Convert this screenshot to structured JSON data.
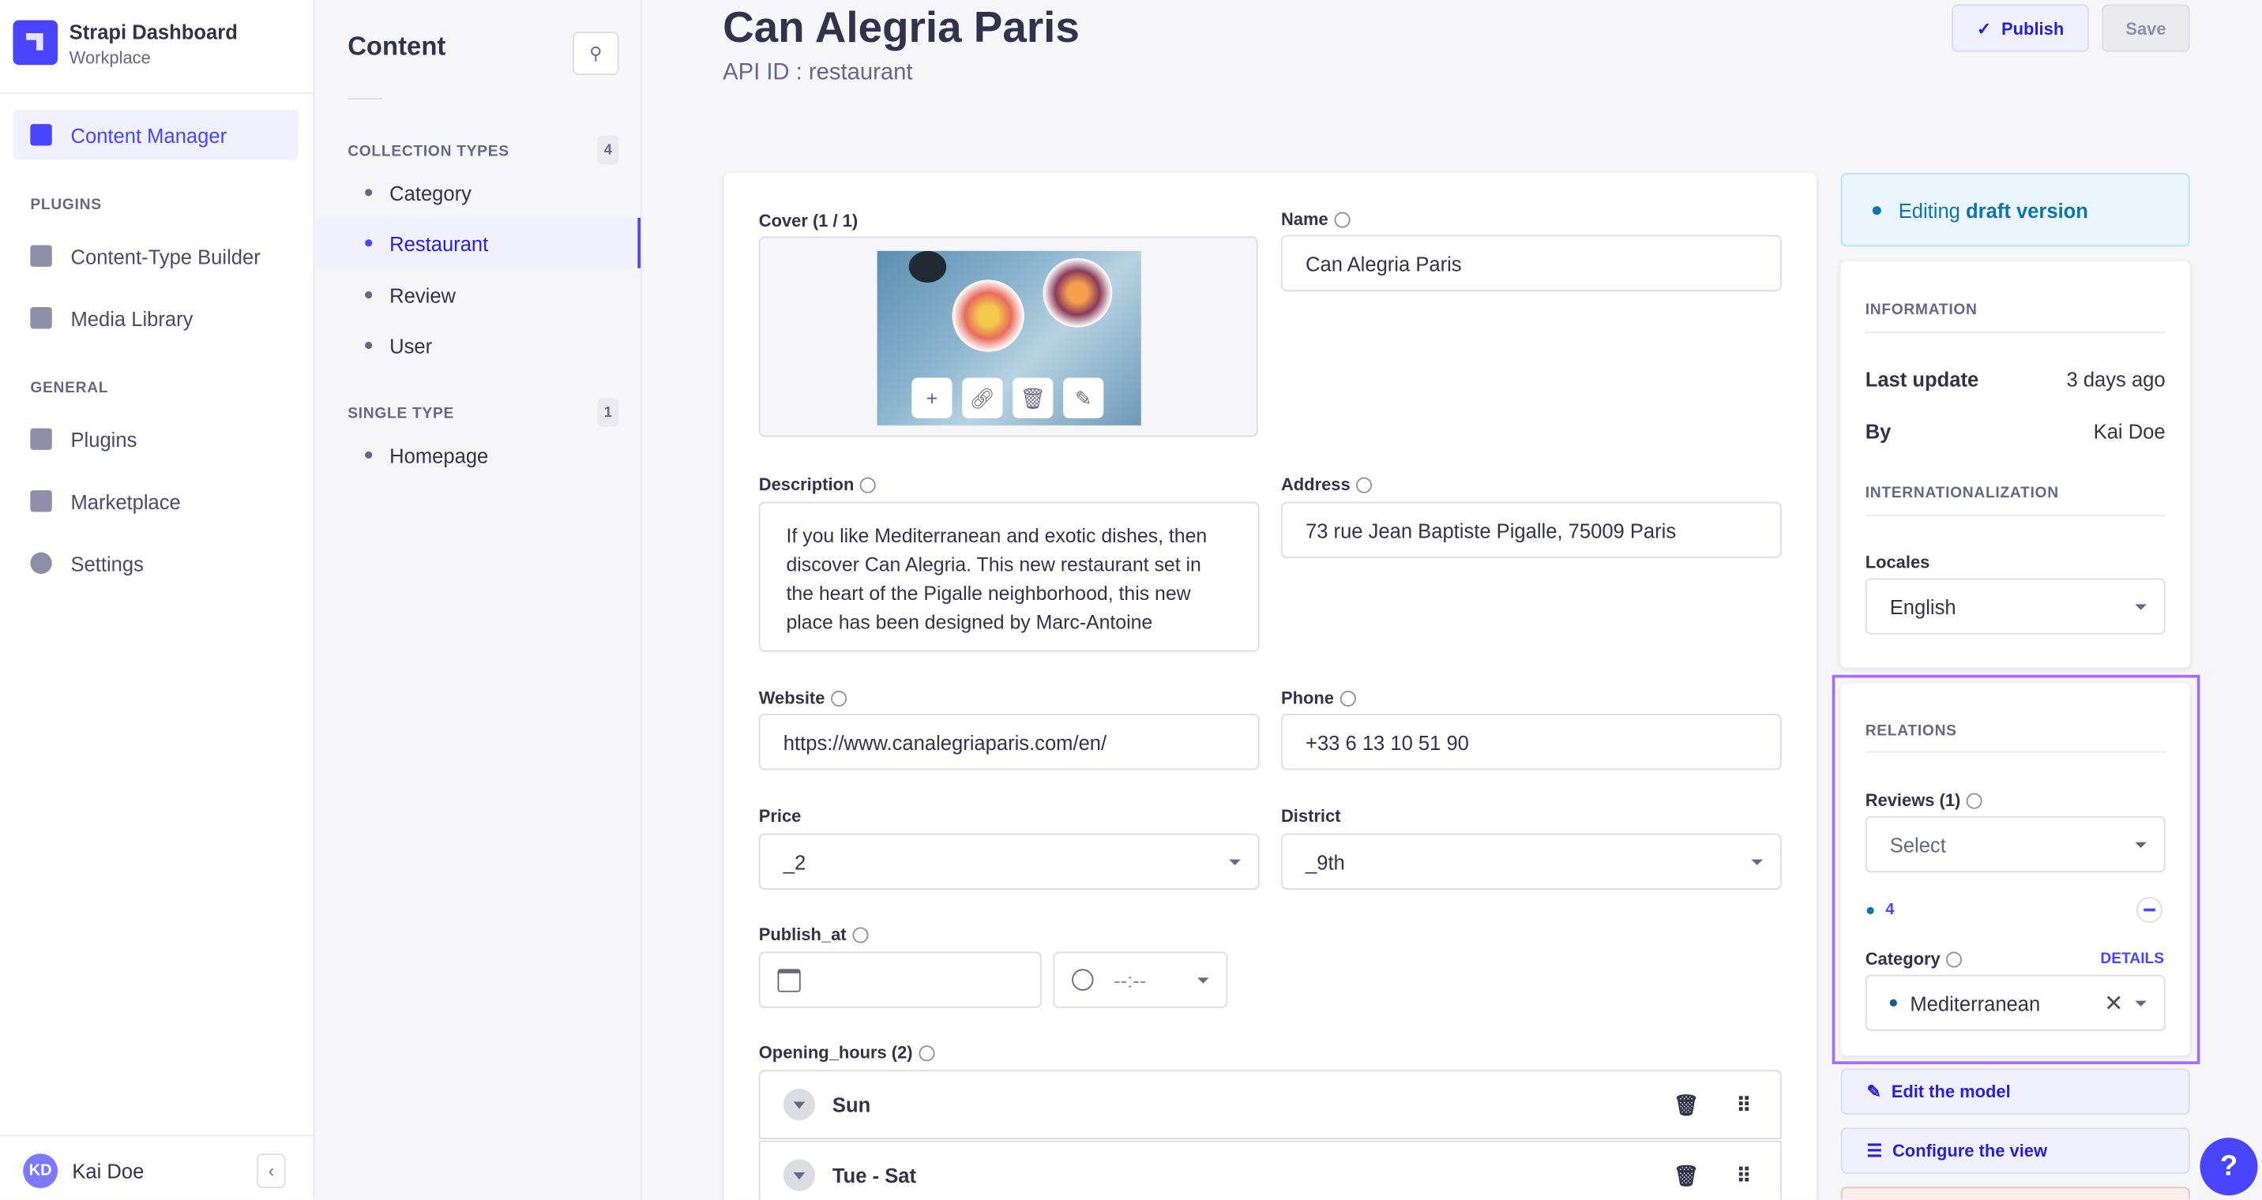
{
  "app": {
    "title": "Strapi Dashboard",
    "subtitle": "Workplace"
  },
  "nav": {
    "active": "Content Manager",
    "plugins_heading": "PLUGINS",
    "plugins": [
      "Content-Type Builder",
      "Media Library"
    ],
    "general_heading": "GENERAL",
    "general": [
      "Plugins",
      "Marketplace",
      "Settings"
    ]
  },
  "user": {
    "initials": "KD",
    "name": "Kai Doe"
  },
  "content_panel": {
    "title": "Content",
    "collection_heading": "COLLECTION TYPES",
    "collection_count": "4",
    "collection_types": [
      "Category",
      "Restaurant",
      "Review",
      "User"
    ],
    "single_heading": "SINGLE TYPE",
    "single_count": "1",
    "single_types": [
      "Homepage"
    ],
    "active": "Restaurant"
  },
  "header": {
    "title": "Can Alegria Paris",
    "api_id": "API ID : restaurant",
    "publish": "Publish",
    "save": "Save"
  },
  "form": {
    "cover_label": "Cover (1 / 1)",
    "name_label": "Name",
    "name_value": "Can Alegria Paris",
    "description_label": "Description",
    "description_value": "If you like Mediterranean and exotic dishes, then discover Can Alegria. This new restaurant set in the heart of the Pigalle neighborhood, this new place has been designed by Marc-Antoine",
    "address_label": "Address",
    "address_value": "73 rue Jean Baptiste Pigalle, 75009 Paris",
    "website_label": "Website",
    "website_value": "https://www.canalegriaparis.com/en/",
    "phone_label": "Phone",
    "phone_value": "+33 6 13 10 51 90",
    "price_label": "Price",
    "price_value": "_2",
    "district_label": "District",
    "district_value": "_9th",
    "publish_at_label": "Publish_at",
    "time_placeholder": "--:--",
    "opening_hours_label": "Opening_hours (2)",
    "opening_hours": [
      "Sun",
      "Tue - Sat"
    ]
  },
  "sidebar_right": {
    "status": "Editing draft version",
    "status_prefix": "Editing ",
    "status_strong": "draft version",
    "info_heading": "INFORMATION",
    "last_update_label": "Last update",
    "last_update_value": "3 days ago",
    "by_label": "By",
    "by_value": "Kai Doe",
    "i18n_heading": "INTERNATIONALIZATION",
    "locales_label": "Locales",
    "locale_value": "English",
    "relations_heading": "RELATIONS",
    "reviews_label": "Reviews (1)",
    "reviews_placeholder": "Select",
    "review_item": "4",
    "category_label": "Category",
    "details_link": "DETAILS",
    "category_value": "Mediterranean",
    "edit_model": "Edit the model",
    "configure_view": "Configure the view"
  },
  "help": "?",
  "colors": {
    "accent": "#4945ff",
    "highlight": "#a56cff",
    "status_bg": "#eaf5ff"
  }
}
